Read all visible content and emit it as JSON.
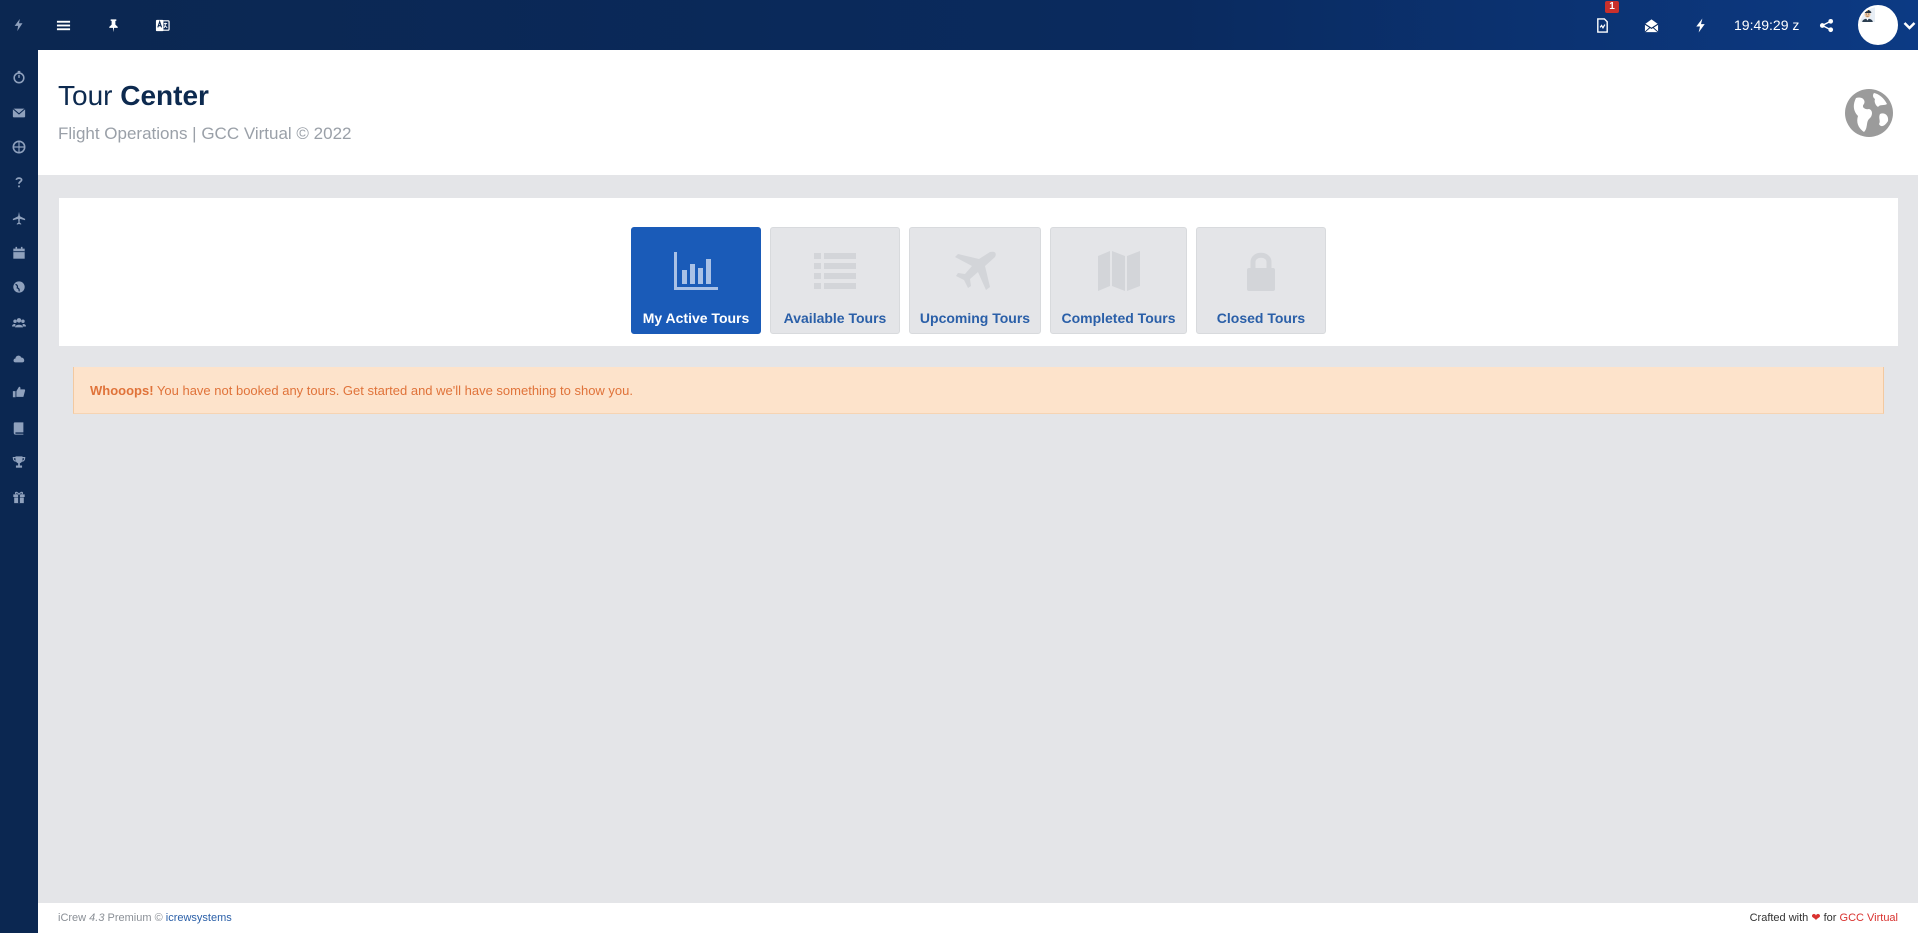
{
  "topbar": {
    "notification_count": "1",
    "clock": "19:49:29 z",
    "icons": [
      "menu-icon",
      "pin-icon",
      "translate-icon",
      "document-icon",
      "mail-open-icon",
      "bolt-icon",
      "share-icon"
    ]
  },
  "sidebar": {
    "items": [
      "bolt-icon",
      "stopwatch-icon",
      "envelope-icon",
      "globe-icon",
      "question-icon",
      "plane-icon",
      "calendar-icon",
      "world-icon",
      "users-icon",
      "cloud-icon",
      "thumbs-up-icon",
      "book-icon",
      "trophy-icon",
      "gift-icon"
    ]
  },
  "header": {
    "title_light": "Tour ",
    "title_bold": "Center",
    "subtitle": "Flight Operations | GCC Virtual © 2022"
  },
  "tabs": [
    {
      "label": "My Active Tours",
      "icon": "bar-chart-icon",
      "active": true
    },
    {
      "label": "Available Tours",
      "icon": "list-icon",
      "active": false
    },
    {
      "label": "Upcoming Tours",
      "icon": "plane-icon",
      "active": false
    },
    {
      "label": "Completed Tours",
      "icon": "map-icon",
      "active": false
    },
    {
      "label": "Closed Tours",
      "icon": "lock-icon",
      "active": false
    }
  ],
  "alert": {
    "strong": "Whooops!",
    "message": " You have not booked any tours. Get started and we'll have something to show you."
  },
  "footer": {
    "product": "iCrew ",
    "version": "4.3",
    "edition": " Premium © ",
    "company_link": "icrewsystems",
    "crafted": "Crafted with ",
    "heart": "❤",
    "for": " for ",
    "brand": "GCC Virtual"
  },
  "colors": {
    "sidebar": "#0b2751",
    "active_tab": "#1a5bb8",
    "alert_bg": "#fde3cb",
    "alert_text": "#e0733a"
  }
}
